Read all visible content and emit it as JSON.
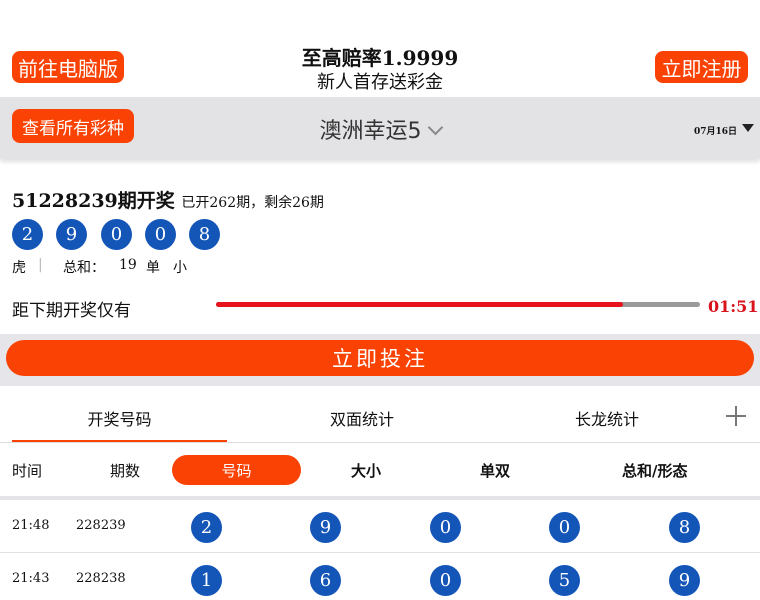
{
  "header": {
    "pc_button": "前往电脑版",
    "promo_title": "至高赔率1.9999",
    "promo_subtitle": "新人首存送彩金",
    "register_button": "立即注册"
  },
  "selector": {
    "all_lotteries_button": "查看所有彩种",
    "lottery_name": "澳洲幸运5",
    "date": "07月16日"
  },
  "draw": {
    "issue": "51228239期开奖",
    "progress_text": "已开262期，剩余26期",
    "balls": [
      "2",
      "9",
      "0",
      "0",
      "8"
    ],
    "attr_dragon_tiger": "虎",
    "attr_sep": "|",
    "sum_label": "总和：",
    "sum_value": "19",
    "odd_even": "单",
    "big_small": "小",
    "countdown_label": "距下期开奖仅有",
    "countdown_time": "01:51",
    "countdown_progress": 0.84
  },
  "bet_button": "立即投注",
  "tabs": [
    {
      "label": "开奖号码",
      "active": true
    },
    {
      "label": "双面统计",
      "active": false
    },
    {
      "label": "长龙统计",
      "active": false
    }
  ],
  "table": {
    "headers": [
      "时间",
      "期数",
      "号码",
      "大小",
      "单双",
      "总和/形态"
    ],
    "rows": [
      {
        "time": "21:48",
        "issue": "228239",
        "balls": [
          "2",
          "9",
          "0",
          "0",
          "8"
        ]
      },
      {
        "time": "21:43",
        "issue": "228238",
        "balls": [
          "1",
          "6",
          "0",
          "5",
          "9"
        ]
      }
    ]
  },
  "colors": {
    "accent": "#f94203",
    "ball": "#1456b8",
    "countdown": "#d8131b"
  }
}
